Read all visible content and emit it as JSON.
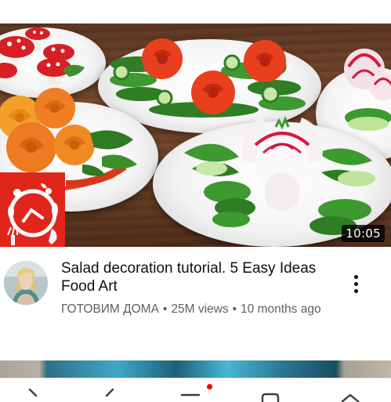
{
  "video": {
    "title": "Salad decoration tutorial. 5 Easy Ideas Food Art",
    "channel": "ГОТОВИМ ДОМА",
    "views": "25M views",
    "age": "10 months ago",
    "separator": "•",
    "duration": "10:05"
  },
  "icons": {
    "more": "more-vert-icon",
    "channel_logo": "fork-spoon-plate-logo",
    "nav_back": "chevron-left-icon",
    "nav_forward": "chevron-right-icon",
    "nav_menu": "menu-icon",
    "nav_tabs": "tabs-icon",
    "nav_home": "home-icon"
  },
  "colors": {
    "channel_logo_bg": "#e0261b",
    "notification_dot": "#ff0000",
    "title_text": "#0f0f0f",
    "secondary_text": "#606060"
  }
}
